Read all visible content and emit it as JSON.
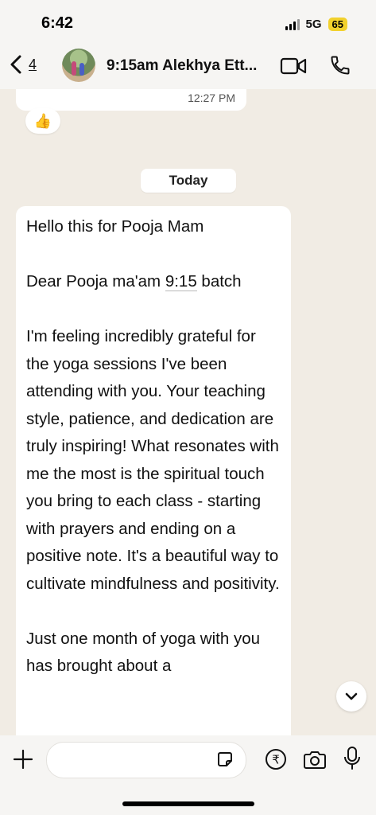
{
  "status": {
    "time": "6:42",
    "network": "5G",
    "battery": "65"
  },
  "header": {
    "back_count": "4",
    "title": "9:15am Alekhya Ett...",
    "icons": [
      "chevron-left-icon",
      "video-call-icon",
      "phone-icon"
    ]
  },
  "chat": {
    "previous_message_time": "12:27 PM",
    "reaction": "👍",
    "date_separator": "Today",
    "message": {
      "line_1": "Hello this for Pooja Mam",
      "greeting_prefix": "Dear Pooja ma'am ",
      "greeting_time": "9:15",
      "greeting_suffix": " batch",
      "paragraph_1": "I'm feeling incredibly grateful for the yoga sessions I've been attending with you. Your teaching style, patience, and dedication are truly inspiring! What resonates with me the most is the spiritual touch you bring to each class - starting with prayers and ending on a positive note. It's a beautiful way to cultivate mindfulness and positivity.",
      "paragraph_2": "Just one month of yoga with you has brought about a"
    }
  },
  "composer": {
    "placeholder": "",
    "icons": [
      "plus-icon",
      "sticker-icon",
      "rupee-payment-icon",
      "camera-icon",
      "microphone-icon"
    ]
  }
}
